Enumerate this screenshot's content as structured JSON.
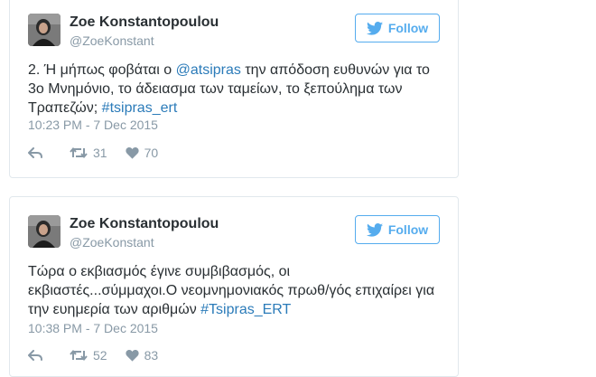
{
  "follow_label": "Follow",
  "colors": {
    "accent": "#55acee",
    "link": "#2b7bb9",
    "muted": "#8899a6",
    "border": "#e1e8ed"
  },
  "tweets": [
    {
      "name": "Zoe Konstantopoulou",
      "handle": "@ZoeKonstant",
      "text_pre": "2. Ή μήπως φοβάται ο ",
      "mention": "@atsipras",
      "text_mid": " την απόδοση ευθυνών για το 3ο Μνημόνιο, το άδειασμα των ταμείων, το ξεπούλημα των Τραπεζών; ",
      "hashtag": "#tsipras_ert",
      "time": "10:23 PM - 7 Dec 2015",
      "retweets": "31",
      "likes": "70"
    },
    {
      "name": "Zoe Konstantopoulou",
      "handle": "@ZoeKonstant",
      "text_pre": "Τώρα ο εκβιασμός έγινε συμβιβασμός, οι εκβιαστές...σύμμαχοι.Ο νεομνημονιακός πρωθ/γός επιχαίρει για την ευημερία των αριθμών ",
      "hashtag": "#Tsipras_ERT",
      "time": "10:38 PM - 7 Dec 2015",
      "retweets": "52",
      "likes": "83"
    }
  ]
}
